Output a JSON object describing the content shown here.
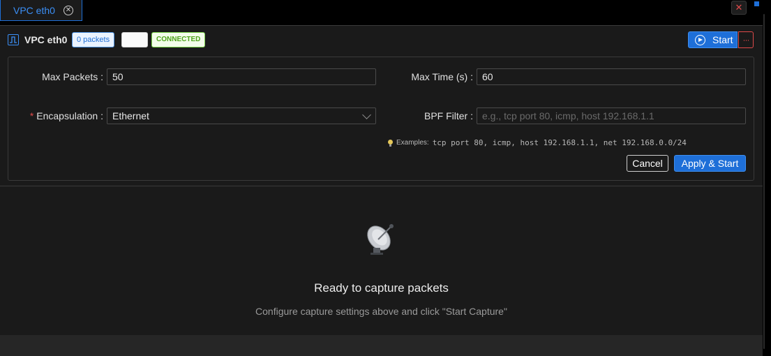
{
  "tab": {
    "label": "VPC eth0",
    "close_glyph": "✕"
  },
  "window": {
    "close_glyph": "✕"
  },
  "header": {
    "title": "VPC eth0",
    "packets_badge": "0 packets",
    "status_badge": "CONNECTED",
    "start_label": "Start",
    "more_glyph": "···"
  },
  "settings": {
    "max_packets_label": "Max Packets :",
    "max_packets_value": "50",
    "max_time_label": "Max Time (s) :",
    "max_time_value": "60",
    "encapsulation_required": "*",
    "encapsulation_label": "Encapsulation :",
    "encapsulation_value": "Ethernet",
    "bpf_label": "BPF Filter :",
    "bpf_placeholder": "e.g., tcp port 80, icmp, host 192.168.1.1",
    "hint_prefix": "Examples:",
    "hint_text": "tcp port 80, icmp, host 192.168.1.1, net 192.168.0.0/24",
    "cancel_label": "Cancel",
    "apply_label": "Apply & Start"
  },
  "empty_state": {
    "icon": "satellite-dish-icon",
    "title": "Ready to capture packets",
    "subtitle": "Configure capture settings above and click \"Start Capture\""
  },
  "colors": {
    "accent": "#1e6fd8",
    "connected": "#4fa31c",
    "danger": "#e04a4a",
    "background": "#1a1a1a"
  }
}
